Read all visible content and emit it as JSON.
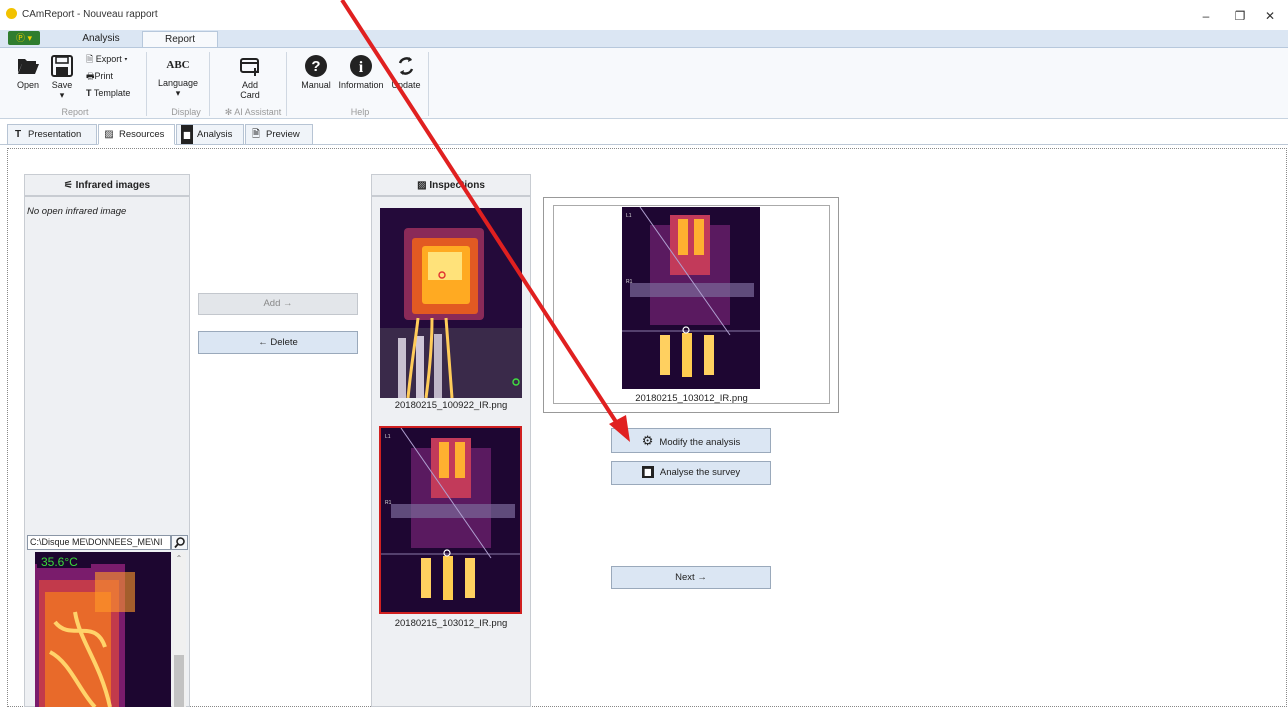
{
  "window": {
    "title": "CAmReport - Nouveau rapport",
    "minimize_glyph": "–",
    "maximize_glyph": "❐",
    "close_glyph": "✕"
  },
  "ribbon": {
    "app_menu_label": "Ⓟ ▾",
    "tabs": [
      "Analysis",
      "Report"
    ],
    "active_tab": "Report",
    "groups": {
      "report": {
        "label": "Report",
        "open": "Open",
        "save": "Save",
        "save_arrow": "▾",
        "export": "Export ▾",
        "print": "Print",
        "template": "Template"
      },
      "display": {
        "label": "Display",
        "language_icon": "ABC",
        "language": "Language",
        "language_arrow": "▾"
      },
      "ai": {
        "label": "AI Assistant",
        "add_card_line1": "Add",
        "add_card_line2": "Card"
      },
      "help": {
        "label": "Help",
        "manual": "Manual",
        "information": "Information",
        "update": "Update"
      }
    }
  },
  "page_tabs": [
    "Presentation",
    "Resources",
    "Analysis",
    "Preview"
  ],
  "active_page_tab": "Resources",
  "infrared_panel": {
    "title": "Infrared images",
    "empty_text": "No open infrared image",
    "path": "C:\\Disque ME\\DONNEES_ME\\NI",
    "preview_temp": "35.6°C"
  },
  "actions": {
    "add": "Add →",
    "delete": "←  Delete"
  },
  "inspections_panel": {
    "title": "Inspections",
    "items": [
      {
        "filename": "20180215_100922_IR.png",
        "selected": false
      },
      {
        "filename": "20180215_103012_IR.png",
        "selected": true
      }
    ]
  },
  "preview": {
    "filename": "20180215_103012_IR.png"
  },
  "analysis_buttons": {
    "modify": "Modify the analysis",
    "analyse": "Analyse the survey",
    "next": "Next →"
  },
  "colors": {
    "arrow": "#e02020",
    "selected_border": "#d02020",
    "ribbon_bg": "#f7f9fc"
  }
}
